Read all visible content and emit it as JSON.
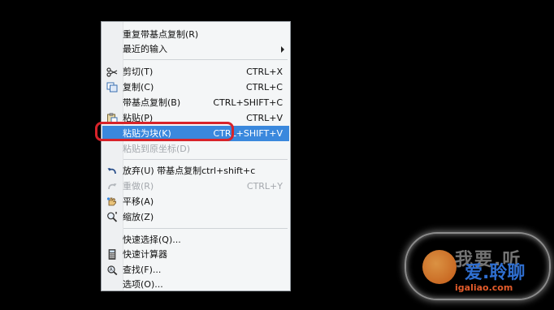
{
  "menu": {
    "items": [
      {
        "label": "重复带基点复制(R)",
        "shortcut": "",
        "icon": "",
        "state": "normal",
        "submenu": false
      },
      {
        "label": "最近的输入",
        "shortcut": "",
        "icon": "",
        "state": "normal",
        "submenu": true
      },
      {
        "label": "剪切(T)",
        "shortcut": "CTRL+X",
        "icon": "scissors-icon",
        "state": "normal",
        "submenu": false
      },
      {
        "label": "复制(C)",
        "shortcut": "CTRL+C",
        "icon": "copy-icon",
        "state": "normal",
        "submenu": false
      },
      {
        "label": "带基点复制(B)",
        "shortcut": "CTRL+SHIFT+C",
        "icon": "",
        "state": "normal",
        "submenu": false
      },
      {
        "label": "粘贴(P)",
        "shortcut": "CTRL+V",
        "icon": "paste-icon",
        "state": "normal",
        "submenu": false
      },
      {
        "label": "粘贴为块(K)",
        "shortcut": "CTRL+SHIFT+V",
        "icon": "",
        "state": "highlighted",
        "submenu": false
      },
      {
        "label": "粘贴到原坐标(D)",
        "shortcut": "",
        "icon": "",
        "state": "disabled",
        "submenu": false
      },
      {
        "label": "放弃(U) 带基点复制ctrl+shift+c",
        "shortcut": "",
        "icon": "undo-icon",
        "state": "normal",
        "submenu": false
      },
      {
        "label": "重做(R)",
        "shortcut": "CTRL+Y",
        "icon": "redo-icon",
        "state": "disabled",
        "submenu": false
      },
      {
        "label": "平移(A)",
        "shortcut": "",
        "icon": "pan-icon",
        "state": "normal",
        "submenu": false
      },
      {
        "label": "缩放(Z)",
        "shortcut": "",
        "icon": "zoom-icon",
        "state": "normal",
        "submenu": false
      },
      {
        "label": "快速选择(Q)...",
        "shortcut": "",
        "icon": "",
        "state": "normal",
        "submenu": false
      },
      {
        "label": "快速计算器",
        "shortcut": "",
        "icon": "calculator-icon",
        "state": "normal",
        "submenu": false
      },
      {
        "label": "查找(F)...",
        "shortcut": "",
        "icon": "find-icon",
        "state": "normal",
        "submenu": false
      },
      {
        "label": "选项(O)...",
        "shortcut": "",
        "icon": "",
        "state": "normal",
        "submenu": false
      }
    ]
  },
  "colors": {
    "highlight": "#3a88dd",
    "annotation": "#d8232a",
    "menu_bg": "#f4f6f7"
  },
  "watermark": {
    "line1": "我要.听",
    "line2": "爱.聆聊",
    "line3": "igaliao.com"
  }
}
